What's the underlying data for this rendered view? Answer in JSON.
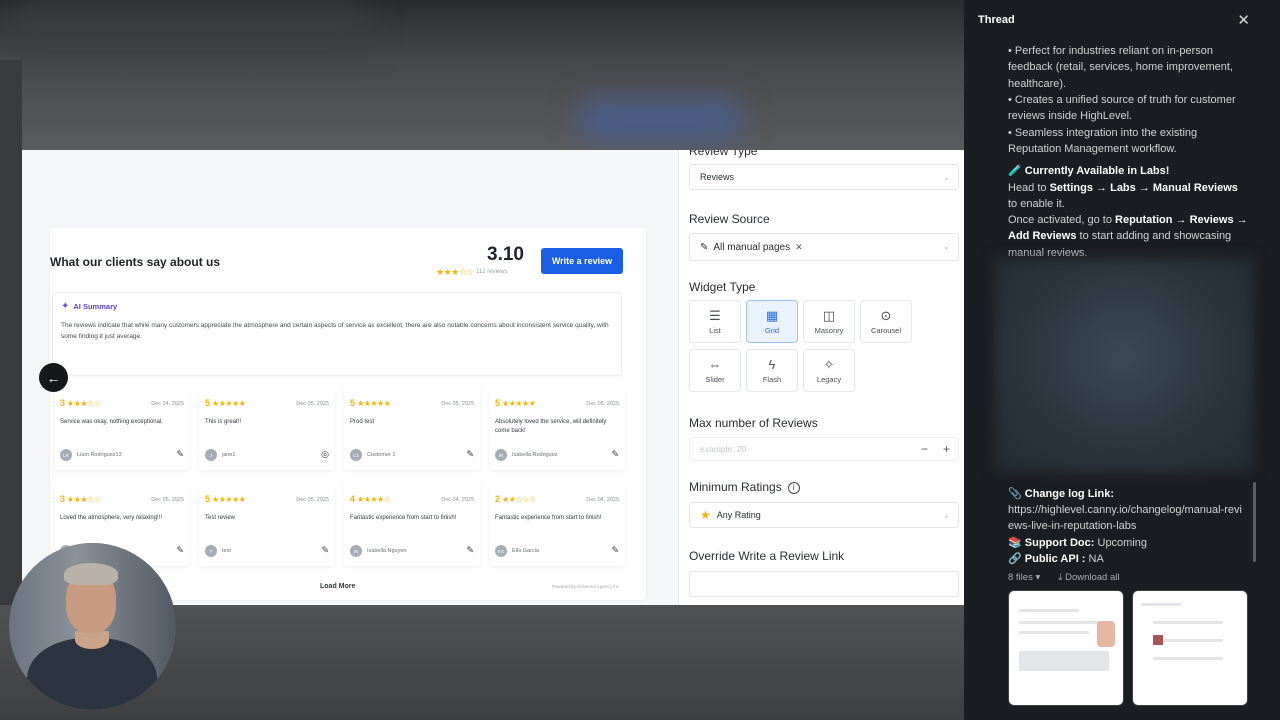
{
  "preview": {
    "widget_title": "What our clients say about us",
    "rating": "3.10",
    "rating_stars": "★★★☆☆",
    "review_count": "112 reviews",
    "write_button": "Write a review",
    "ai_title": "AI Summary",
    "ai_text": "The reviews indicate that while many customers appreciate the atmosphere and certain aspects of service as excellent, there are also notable concerns about inconsistent service quality, with some finding it just average.",
    "load_more": "Load More",
    "powered_by": "Powered by Universal Agency Inc",
    "reviews": [
      {
        "score": "3",
        "stars": "★★★☆☆",
        "date": "Dec 24, 2025",
        "text": "Service was okay, nothing exceptional.",
        "initials": "LR",
        "name": "Liam Rodriguez13",
        "icon": "✎"
      },
      {
        "score": "5",
        "stars": "★★★★★",
        "date": "Dec 05, 2025",
        "text": "This is great!!",
        "initials": "J",
        "name": "jane1",
        "icon": "◎"
      },
      {
        "score": "5",
        "stars": "★★★★★",
        "date": "Dec 05, 2025",
        "text": "Prod test",
        "initials": "C1",
        "name": "Customer 1",
        "icon": "✎"
      },
      {
        "score": "5",
        "stars": "★★★★★",
        "date": "Dec 05, 2025",
        "text": "Absolutely loved the service, will definitely come back!",
        "initials": "IR",
        "name": "Isabella Rodriguez",
        "icon": "✎"
      },
      {
        "score": "3",
        "stars": "★★★☆☆",
        "date": "Dec 05, 2025",
        "text": "Loved the atmosphere, very relaxing!!!",
        "initials": "IR",
        "name": "",
        "icon": "✎"
      },
      {
        "score": "5",
        "stars": "★★★★★",
        "date": "Dec 05, 2025",
        "text": "Test review",
        "initials": "T",
        "name": "test",
        "icon": "✎"
      },
      {
        "score": "4",
        "stars": "★★★★☆",
        "date": "Dec 04, 2025",
        "text": "Fantastic experience from start to finish!",
        "initials": "IN",
        "name": "Isabella Nguyen",
        "icon": "✎"
      },
      {
        "score": "2",
        "stars": "★★☆☆☆",
        "date": "Dec 04, 2025",
        "text": "Fantastic experience from start to finish!",
        "initials": "EG",
        "name": "Ella Garcia",
        "icon": "✎"
      }
    ]
  },
  "settings": {
    "review_type_label": "Review Type",
    "review_type_value": "Reviews",
    "review_source_label": "Review Source",
    "review_source_chip": "All manual pages",
    "widget_type_label": "Widget Type",
    "widget_types": [
      {
        "label": "List",
        "icon": "☰"
      },
      {
        "label": "Grid",
        "icon": "▦"
      },
      {
        "label": "Masonry",
        "icon": "◫"
      },
      {
        "label": "Carousel",
        "icon": "⊙"
      },
      {
        "label": "Slider",
        "icon": "⇔"
      },
      {
        "label": "Flash",
        "icon": "ϟ"
      },
      {
        "label": "Legacy",
        "icon": "✧"
      }
    ],
    "max_reviews_label": "Max number of Reviews",
    "max_reviews_placeholder": "example: 20",
    "min_ratings_label": "Minimum Ratings",
    "min_ratings_value": "Any Rating",
    "override_label": "Override Write a Review Link"
  },
  "thread": {
    "title": "Thread",
    "bullets": [
      "• Perfect for industries reliant on in-person feedback (retail, services, home improvement, healthcare).",
      "• Creates a unified source of truth for customer reviews inside HighLevel.",
      "• Seamless integration into the existing Reputation Management workflow."
    ],
    "labs_heading": "Currently Available in Labs!",
    "labs_emoji": "🧪",
    "labs_line1_pre": "Head to ",
    "labs_line1_bold": "Settings → Labs → Manual Reviews",
    "labs_line1_post": " to enable it.",
    "labs_line2_pre": "Once activated, go to ",
    "labs_line2_bold": "Reputation → Reviews → Add Reviews",
    "labs_line2_post": " to start adding and showcasing manual reviews.",
    "changelog_label": "Change log Link:",
    "changelog_url": "https://highlevel.canny.io/changelog/manual-reviews-live-in-reputation-labs",
    "support_label": "Support Doc:",
    "support_value": "Upcoming",
    "api_label": "Public API :",
    "api_value": "NA",
    "files_count": "8 files",
    "download_all": "Download all"
  }
}
